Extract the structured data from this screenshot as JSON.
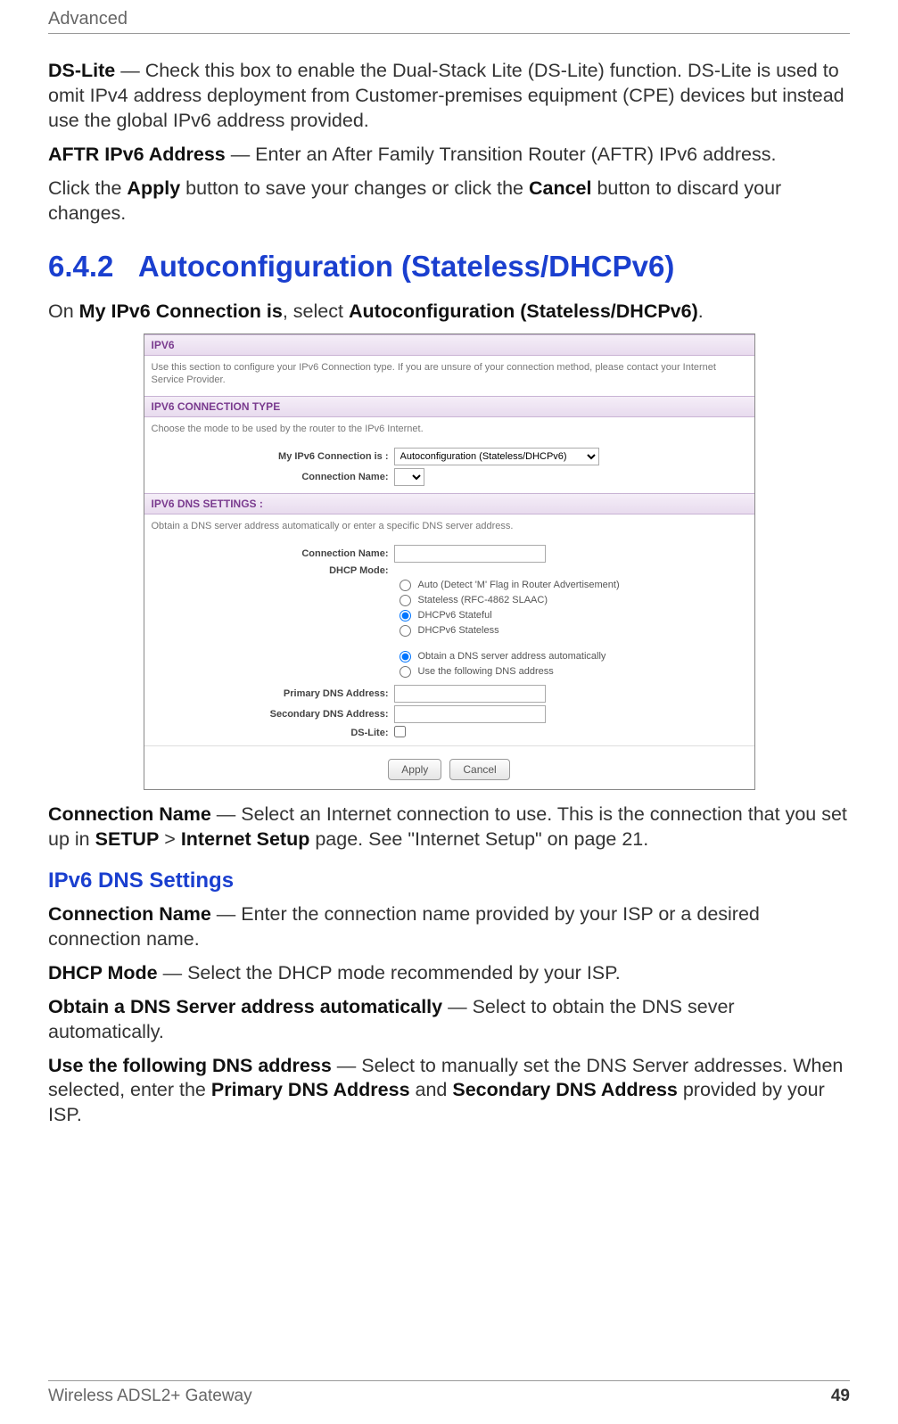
{
  "header": {
    "title": "Advanced"
  },
  "intro": {
    "dslite_term": "DS-Lite",
    "dslite_text": " — Check this box to enable the Dual-Stack Lite (DS-Lite) function. DS-Lite is used to omit IPv4 address deployment from Customer-premises equipment (CPE) devices but instead use the global IPv6 address provided.",
    "aftr_term": "AFTR IPv6 Address",
    "aftr_text": " — Enter an After Family Transition Router (AFTR) IPv6 address.",
    "apply_pre": "Click the ",
    "apply_b": "Apply",
    "apply_mid": " button to save your changes or click the ",
    "cancel_b": "Cancel",
    "apply_post": " button to discard your changes."
  },
  "section": {
    "num": "6.4.2",
    "title": "Autoconfiguration (Stateless/DHCPv6)",
    "sel_pre": "On ",
    "sel_b1": "My IPv6 Connection is",
    "sel_mid": ", select ",
    "sel_b2": "Autoconfiguration (Stateless/DHCPv6)",
    "sel_post": "."
  },
  "shot": {
    "ipv6_bar": "IPV6",
    "ipv6_note": "Use this section to configure your IPv6 Connection type. If you are unsure of your connection method, please contact your Internet Service Provider.",
    "conn_bar": "IPV6 CONNECTION TYPE",
    "conn_note": "Choose the mode to be used by the router to the IPv6 Internet.",
    "my_conn_label": "My IPv6 Connection is :",
    "my_conn_value": "Autoconfiguration (Stateless/DHCPv6)",
    "conn_name_label": "Connection Name:",
    "dns_bar": "IPV6 DNS SETTINGS :",
    "dns_note": "Obtain a DNS server address automatically or enter a specific DNS server address.",
    "dns_conn_label": "Connection Name:",
    "dhcp_mode_label": "DHCP Mode:",
    "radios": {
      "auto": "Auto (Detect 'M' Flag in Router Advertisement)",
      "slaac": "Stateless (RFC-4862 SLAAC)",
      "stateful": "DHCPv6 Stateful",
      "stateless": "DHCPv6 Stateless",
      "obtain": "Obtain a DNS server address automatically",
      "use": "Use the following DNS address"
    },
    "primary_label": "Primary DNS Address:",
    "secondary_label": "Secondary DNS Address:",
    "dslite_label": "DS-Lite:",
    "apply_btn": "Apply",
    "cancel_btn": "Cancel"
  },
  "after": {
    "conn_term": "Connection Name",
    "conn_text_a": " — Select an Internet connection to use. This is the connection that you set up in ",
    "conn_b1": "SETUP",
    "conn_gt": " > ",
    "conn_b2": "Internet Setup",
    "conn_text_b": " page. See \"Internet Setup\" on page 21.",
    "h3": "IPv6 DNS Settings",
    "conn2_term": "Connection Name",
    "conn2_text": " — Enter the connection name provided by your ISP or a desired connection name.",
    "dhcp_term": "DHCP Mode",
    "dhcp_text": " — Select the DHCP mode recommended by your ISP.",
    "obtain_term": "Obtain a DNS Server address automatically",
    "obtain_text": " — Select to obtain the DNS sever automatically.",
    "use_term": "Use the following DNS address",
    "use_text_a": " — Select to manually set the DNS Server addresses. When selected, enter the ",
    "use_b1": "Primary DNS Address",
    "use_and": " and ",
    "use_b2": "Secondary DNS Address",
    "use_text_b": " provided by your ISP."
  },
  "footer": {
    "product": "Wireless ADSL2+ Gateway",
    "page": "49"
  }
}
